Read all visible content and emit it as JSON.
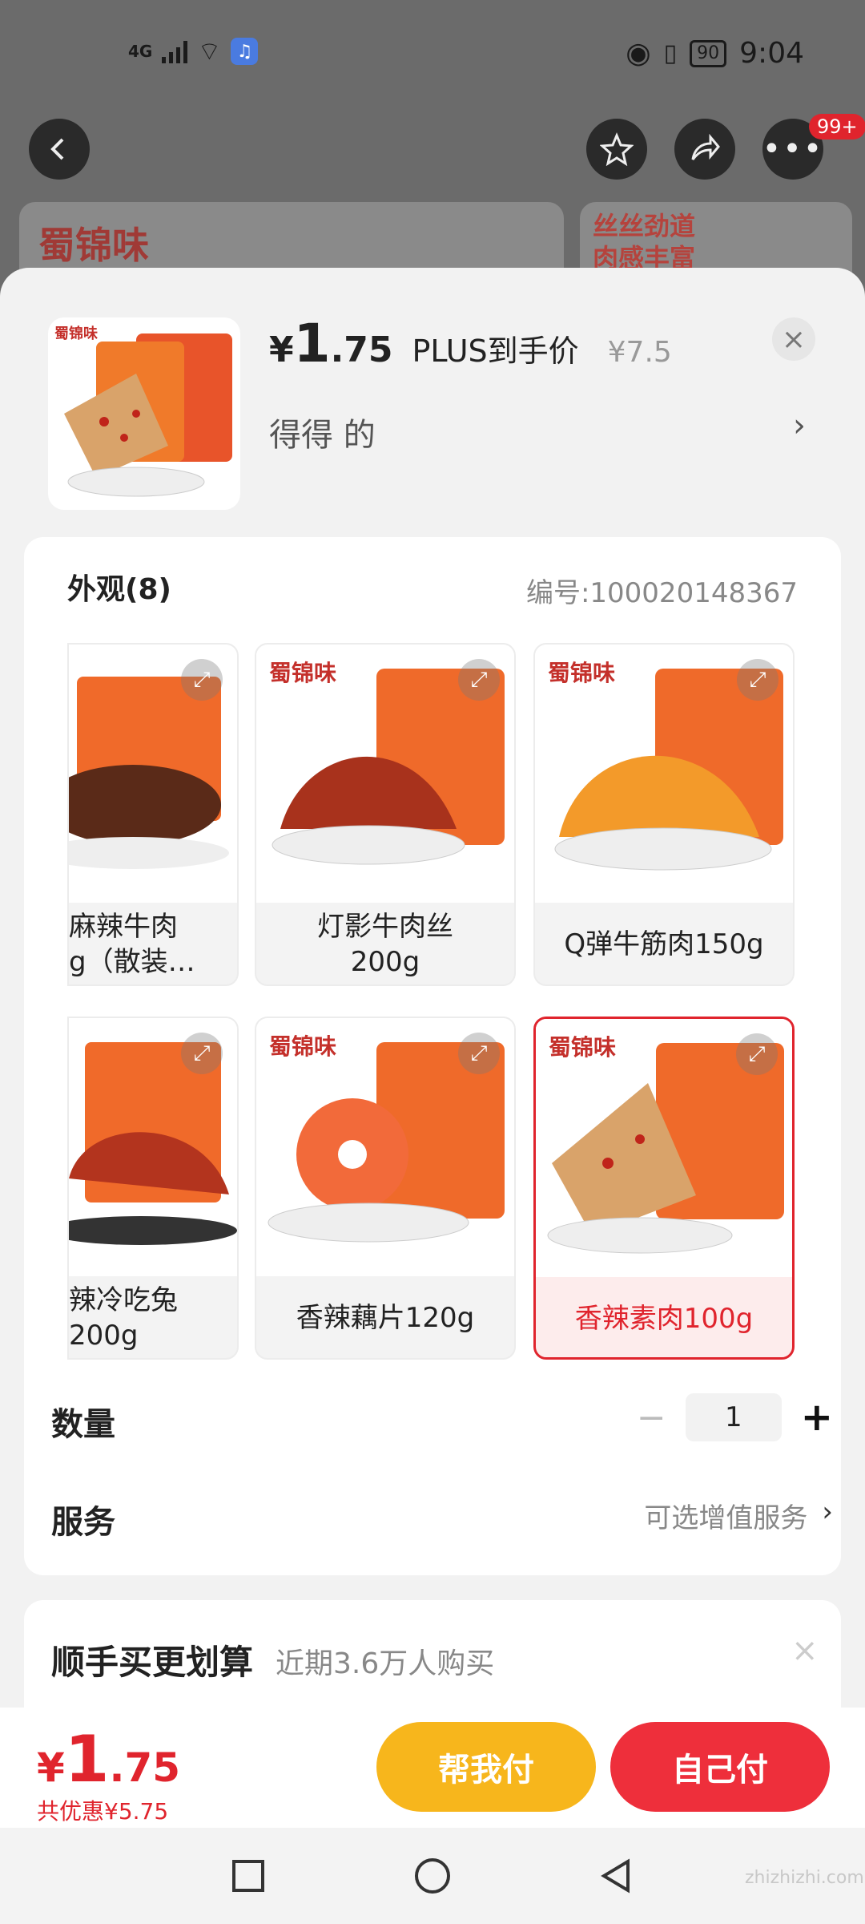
{
  "status_bar": {
    "network": "4G",
    "time": "9:04",
    "battery": "90"
  },
  "background": {
    "brand_logo": "蜀锦味",
    "promo_line1": "丝丝劲道",
    "promo_line2": "肉感丰富",
    "more_badge": "99+"
  },
  "header": {
    "price_yen": "¥",
    "price_int": "1",
    "price_dec": ".75",
    "price_label": "PLUS到手价",
    "original_price": "¥7.5",
    "subtitle": "得得  的",
    "chevron": "›",
    "close": "×"
  },
  "variants_section": {
    "title": "外观(8)",
    "code": "编号:100020148367",
    "items": [
      {
        "label": "麻辣牛肉\ng（散装…",
        "selected": false
      },
      {
        "label": "灯影牛肉丝\n200g",
        "selected": false
      },
      {
        "label": "Q弹牛筋肉150g",
        "selected": false
      },
      {
        "label": "辣冷吃兔\n200g",
        "selected": false
      },
      {
        "label": "香辣藕片120g",
        "selected": false
      },
      {
        "label": "香辣素肉100g",
        "selected": true
      }
    ],
    "brand_tag": "蜀锦味"
  },
  "quantity": {
    "label": "数量",
    "minus": "−",
    "value": "1",
    "plus": "+"
  },
  "service": {
    "label": "服务",
    "value": "可选增值服务",
    "chevron": "›"
  },
  "upsell": {
    "title": "顺手买更划算",
    "subtitle": "近期3.6万人购买",
    "close": "×"
  },
  "footer": {
    "price_yen": "¥",
    "price_int": "1",
    "price_dec": ".75",
    "saving": "共优惠¥5.75",
    "help_pay": "帮我付",
    "self_pay": "自己付"
  },
  "watermark": "zhizhizhi.com",
  "colors": {
    "accent_red": "#e0242d",
    "help_yellow": "#f7b61c",
    "pay_red": "#ee2f3b"
  }
}
